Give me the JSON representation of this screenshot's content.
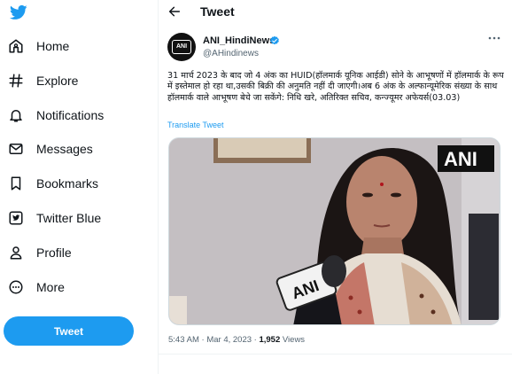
{
  "app": {
    "brand_color": "#1d9bf0"
  },
  "sidebar": {
    "items": [
      {
        "label": "Home",
        "icon": "home-icon"
      },
      {
        "label": "Explore",
        "icon": "hashtag-icon"
      },
      {
        "label": "Notifications",
        "icon": "bell-icon"
      },
      {
        "label": "Messages",
        "icon": "envelope-icon"
      },
      {
        "label": "Bookmarks",
        "icon": "bookmark-icon"
      },
      {
        "label": "Twitter Blue",
        "icon": "twitter-blue-icon"
      },
      {
        "label": "Profile",
        "icon": "person-icon"
      },
      {
        "label": "More",
        "icon": "more-circle-icon"
      }
    ],
    "tweet_button": "Tweet"
  },
  "header": {
    "title": "Tweet"
  },
  "tweet": {
    "author_name": "ANI_HindiNews",
    "author_handle": "@AHindinews",
    "avatar_text": "ANI",
    "text": "31 मार्च 2023 के बाद जो 4 अंक का HUID(हॉलमार्क यूनिक आईडी) सोने के आभूषणों में हॉलमार्क के रूप में इस्तेमाल हो रहा था,उसकी बिक्री की अनुमति नहीं दी जाएगी।अब 6 अंक के अल्फान्यूमेरिक संख्या के साथ हॉलमार्क वाले आभूषण बेचे जा सकेंगे: निधि खरे, अतिरिक्त सचिव, कन्ज्यूमर अफेयर्स(03.03)",
    "translate_label": "Translate Tweet",
    "media_watermark": "ANI",
    "mic_label": "ANI",
    "time": "5:43 AM",
    "sep": "·",
    "date": "Mar 4, 2023",
    "views_count": "1,952",
    "views_label": "Views"
  }
}
